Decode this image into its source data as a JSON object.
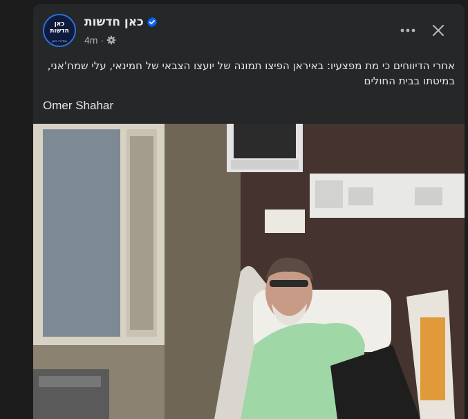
{
  "post": {
    "page_name": "כאן חדשות",
    "avatar_text": "כאן\nחדשות",
    "avatar_subtext": "שידורי כאן",
    "time": "4m",
    "icons": {
      "verified": "verified-badge-icon",
      "privacy": "gear-icon",
      "more": "more-icon",
      "close": "close-icon"
    },
    "text": "אחרי הדיווחים כי מת מפצעיו: באיראן הפיצו תמונה של יועצו הצבאי של חמינאי, עלי שמח'אני, במיטתו בבית החולים",
    "author": "Omer Shahar",
    "photo_alt": "hospital-photo",
    "colors": {
      "card_bg": "#252728",
      "page_bg": "#1c1c1d",
      "verified": "#0866ff",
      "text": "#e4e6eb",
      "meta": "#b0b3b8"
    }
  }
}
